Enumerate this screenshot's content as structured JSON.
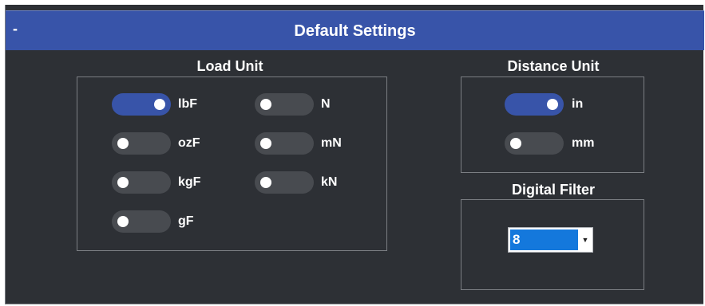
{
  "header": {
    "collapse_label": "-",
    "title": "Default Settings"
  },
  "load_unit": {
    "title": "Load Unit",
    "options": [
      {
        "label": "lbF",
        "on": true
      },
      {
        "label": "ozF",
        "on": false
      },
      {
        "label": "kgF",
        "on": false
      },
      {
        "label": "gF",
        "on": false
      },
      {
        "label": "N",
        "on": false
      },
      {
        "label": "mN",
        "on": false
      },
      {
        "label": "kN",
        "on": false
      }
    ]
  },
  "distance_unit": {
    "title": "Distance Unit",
    "options": [
      {
        "label": "in",
        "on": true
      },
      {
        "label": "mm",
        "on": false
      }
    ]
  },
  "digital_filter": {
    "title": "Digital Filter",
    "selected": "8",
    "arrow_icon": "chevron-down-icon"
  },
  "colors": {
    "panel_bg": "#2d3035",
    "header_bg": "#3854a9",
    "toggle_on": "#3854a9",
    "toggle_off": "#484b50",
    "select_highlight": "#1478dc"
  }
}
